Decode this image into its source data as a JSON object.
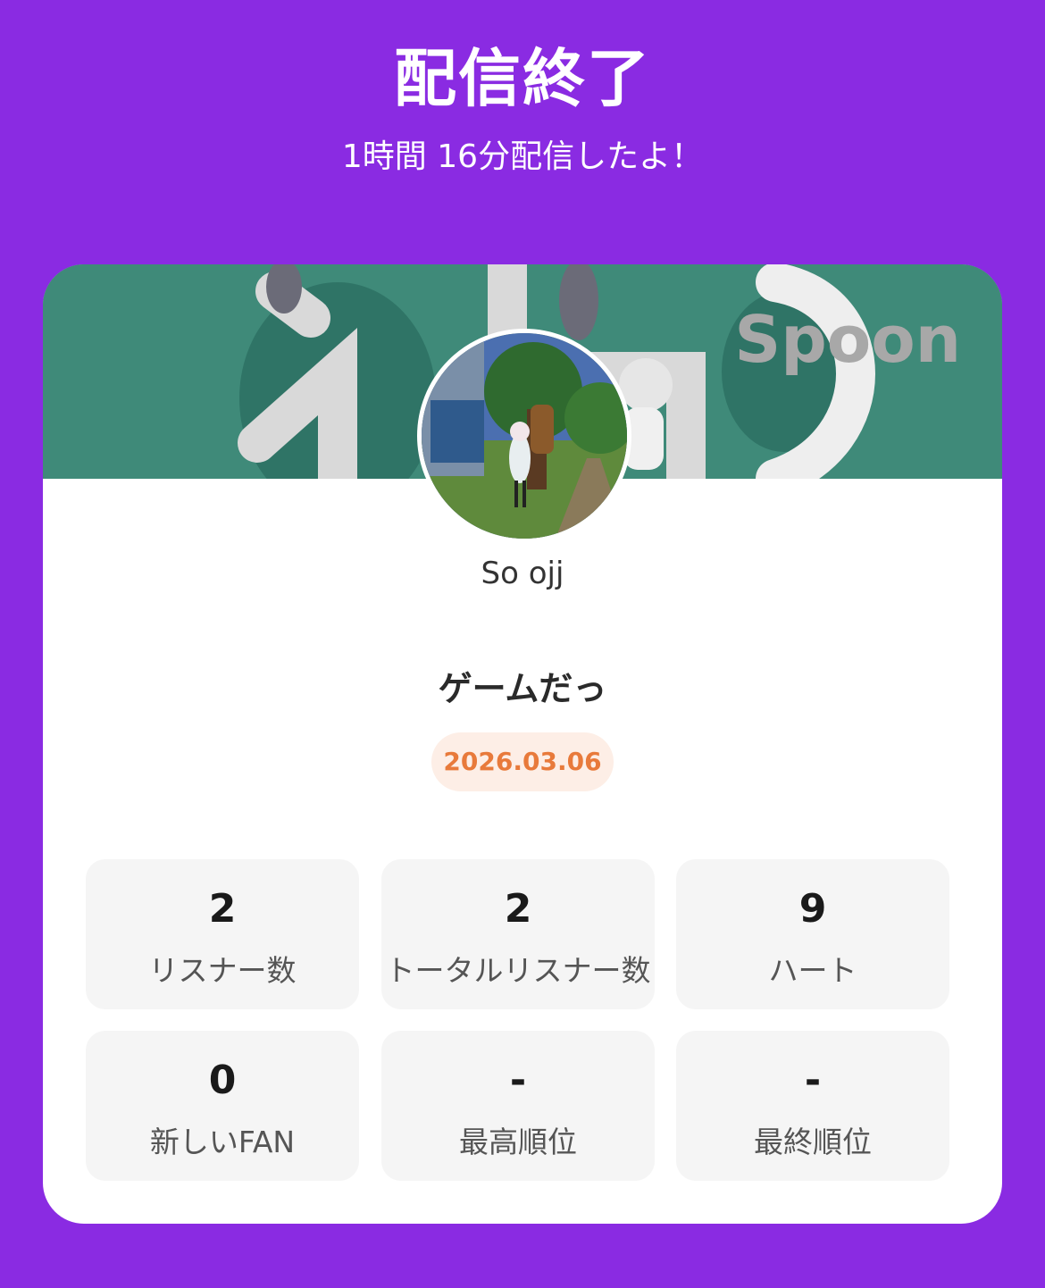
{
  "header": {
    "title": "配信終了",
    "subtitle": "1時間 16分配信したよ！"
  },
  "card": {
    "banner_logo": "Spoon",
    "username": "So ojj",
    "live_title": "ゲームだっ",
    "date": "2026.03.06",
    "stats": [
      {
        "value": "2",
        "label": "リスナー数"
      },
      {
        "value": "2",
        "label": "トータルリスナー数"
      },
      {
        "value": "9",
        "label": "ハート"
      },
      {
        "value": "0",
        "label": "新しいFAN"
      },
      {
        "value": "-",
        "label": "最高順位"
      },
      {
        "value": "-",
        "label": "最終順位"
      }
    ]
  },
  "colors": {
    "background": "#8a2be2",
    "banner": "#3f8a79",
    "date_text": "#e87a3b",
    "date_bg": "#fdeee6"
  }
}
